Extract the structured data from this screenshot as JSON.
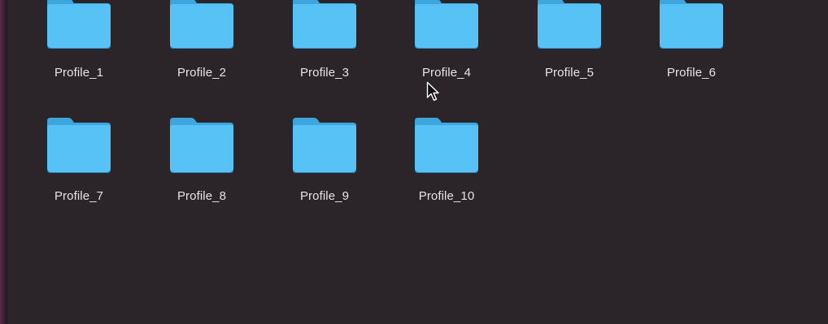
{
  "finder": {
    "folders": [
      {
        "name": "Profile_1"
      },
      {
        "name": "Profile_2"
      },
      {
        "name": "Profile_3"
      },
      {
        "name": "Profile_4"
      },
      {
        "name": "Profile_5"
      },
      {
        "name": "Profile_6"
      },
      {
        "name": "Profile_7"
      },
      {
        "name": "Profile_8"
      },
      {
        "name": "Profile_9"
      },
      {
        "name": "Profile_10"
      }
    ],
    "folder_icon": "folder-icon",
    "colors": {
      "background": "#2b2529",
      "folder_body": "#56c2f5",
      "folder_tab": "#3fa6dd",
      "folder_shadow": "#2d8ac0",
      "label_text": "#e6e3e6"
    }
  }
}
